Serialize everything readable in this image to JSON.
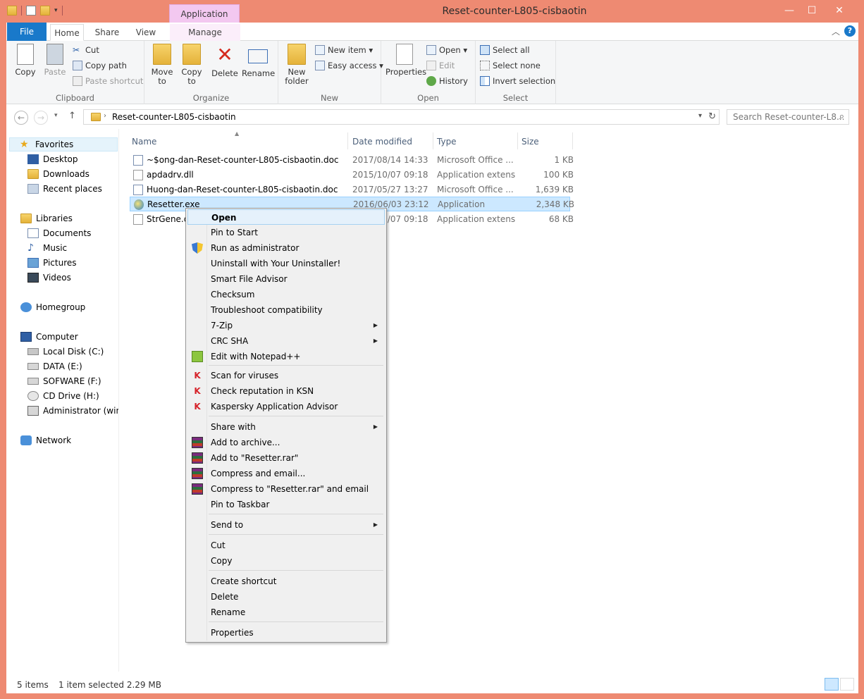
{
  "window": {
    "title": "Reset-counter-L805-cisbaotin",
    "context_tab_group": "Application Tools",
    "controls": {
      "minimize": "—",
      "maximize": "☐",
      "close": "✕"
    }
  },
  "ribbon_tabs": {
    "file": "File",
    "home": "Home",
    "share": "Share",
    "view": "View",
    "manage": "Manage",
    "help": "?"
  },
  "ribbon": {
    "clipboard": {
      "label": "Clipboard",
      "copy": "Copy",
      "paste": "Paste",
      "cut": "Cut",
      "copy_path": "Copy path",
      "paste_shortcut": "Paste shortcut"
    },
    "organize": {
      "label": "Organize",
      "move_to": "Move to",
      "copy_to": "Copy to",
      "delete": "Delete",
      "rename": "Rename"
    },
    "new": {
      "label": "New",
      "new_folder": "New folder",
      "new_item": "New item ▾",
      "easy_access": "Easy access ▾"
    },
    "open": {
      "label": "Open",
      "properties": "Properties",
      "open": "Open ▾",
      "edit": "Edit",
      "history": "History"
    },
    "select": {
      "label": "Select",
      "select_all": "Select all",
      "select_none": "Select none",
      "invert_selection": "Invert selection"
    }
  },
  "address": {
    "path": "Reset-counter-L805-cisbaotin",
    "search_placeholder": "Search Reset-counter-L8..."
  },
  "nav_pane": {
    "favorites": "Favorites",
    "desktop": "Desktop",
    "downloads": "Downloads",
    "recent_places": "Recent places",
    "libraries": "Libraries",
    "documents": "Documents",
    "music": "Music",
    "pictures": "Pictures",
    "videos": "Videos",
    "homegroup": "Homegroup",
    "computer": "Computer",
    "local_disk": "Local Disk (C:)",
    "data": "DATA (E:)",
    "sofware": "SOFWARE (F:)",
    "cd_drive": "CD Drive (H:)",
    "administrator": "Administrator (win-r",
    "network": "Network"
  },
  "columns": {
    "name": "Name",
    "date_modified": "Date modified",
    "type": "Type",
    "size": "Size"
  },
  "files": [
    {
      "name": "~$ong-dan-Reset-counter-L805-cisbaotin.doc",
      "date": "2017/08/14 14:33 ...",
      "type": "Microsoft Office ...",
      "size": "1 KB"
    },
    {
      "name": "apdadrv.dll",
      "date": "2015/10/07 09:18 ...",
      "type": "Application extens...",
      "size": "100 KB"
    },
    {
      "name": "Huong-dan-Reset-counter-L805-cisbaotin.doc",
      "date": "2017/05/27 13:27 ...",
      "type": "Microsoft Office ...",
      "size": "1,639 KB"
    },
    {
      "name": "Resetter.exe",
      "date": "2016/06/03 23:12 ...",
      "type": "Application",
      "size": "2,348 KB"
    },
    {
      "name": "StrGene.dll",
      "date": "2015/10/07 09:18 ...",
      "type": "Application extens...",
      "size": "68 KB"
    }
  ],
  "status": {
    "items": "5 items",
    "selected": "1 item selected  2.29 MB"
  },
  "context_menu": {
    "open": "Open",
    "pin_to_start": "Pin to Start",
    "run_as_admin": "Run as administrator",
    "uninstall": "Uninstall with Your Uninstaller!",
    "smart_file_advisor": "Smart File Advisor",
    "checksum": "Checksum",
    "troubleshoot": "Troubleshoot compatibility",
    "seven_zip": "7-Zip",
    "crc_sha": "CRC SHA",
    "edit_notepad": "Edit with Notepad++",
    "scan_viruses": "Scan for viruses",
    "check_reputation": "Check reputation in KSN",
    "kaspersky_advisor": "Kaspersky Application Advisor",
    "share_with": "Share with",
    "add_to_archive": "Add to archive...",
    "add_to_rar": "Add to \"Resetter.rar\"",
    "compress_email": "Compress and email...",
    "compress_rar_email": "Compress to \"Resetter.rar\" and email",
    "pin_taskbar": "Pin to Taskbar",
    "send_to": "Send to",
    "cut": "Cut",
    "copy": "Copy",
    "create_shortcut": "Create shortcut",
    "delete": "Delete",
    "rename": "Rename",
    "properties": "Properties"
  },
  "colors": {
    "titlebar": "#ee8a72",
    "file_tab": "#1979ca",
    "selection": "#cce8ff",
    "context_tab": "#f3c8f0"
  }
}
